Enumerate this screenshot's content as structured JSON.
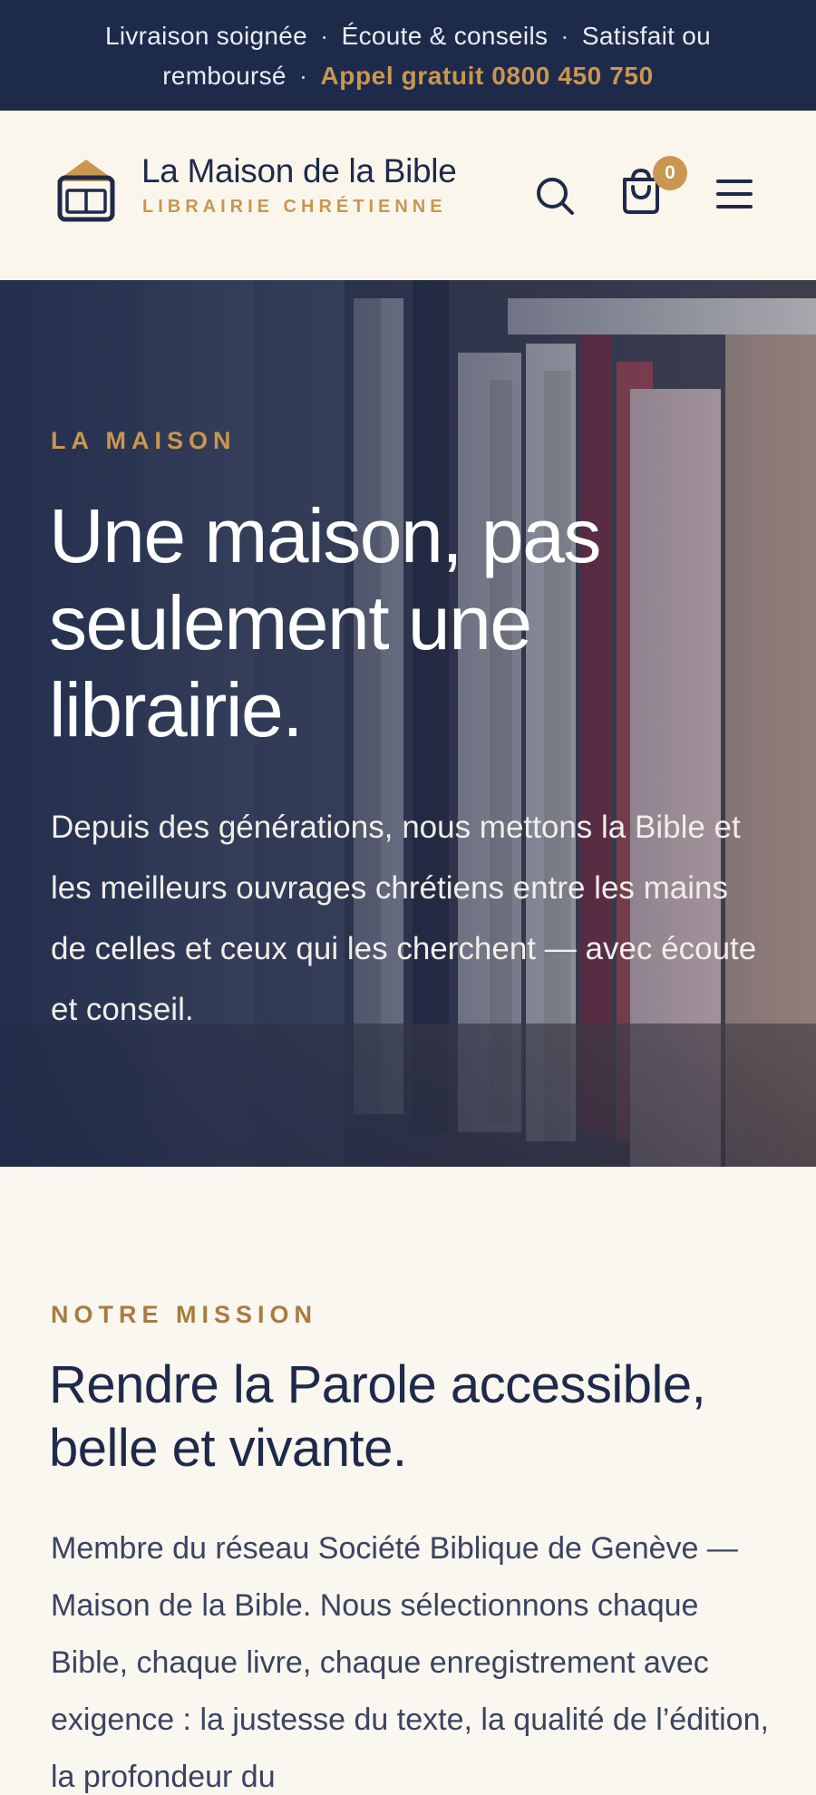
{
  "topbar": {
    "item1": "Livraison soignée",
    "item2": "Écoute & conseils",
    "item3": "Satisfait ou remboursé",
    "separator": "·",
    "phone": "Appel gratuit 0800 450 750"
  },
  "header": {
    "brand_name": "La Maison de la Bible",
    "brand_tagline": "LIBRAIRIE CHRÉTIENNE",
    "cart_count": "0",
    "icons": {
      "logo": "house-book-icon",
      "search": "search-icon",
      "cart": "shopping-bag-icon",
      "menu": "hamburger-menu-icon"
    }
  },
  "hero": {
    "eyebrow": "LA MAISON",
    "title": "Une maison, pas seulement une librairie.",
    "text": "Depuis des générations, nous mettons la Bible et les meilleurs ouvrages chrétiens entre les mains de celles et ceux qui les cherchent — avec écoute et conseil."
  },
  "mission": {
    "eyebrow": "NOTRE MISSION",
    "title": "Rendre la Parole accessible, belle et vivante.",
    "text": "Membre du réseau Société Biblique de Genève — Maison de la Bible. Nous sélectionnons chaque Bible, chaque livre, chaque enregistrement avec exigence : la justesse du texte, la qualité de l’édition, la profondeur du"
  },
  "colors": {
    "navy": "#1e2a4a",
    "gold": "#c9974f",
    "cream": "#faf6f0"
  }
}
